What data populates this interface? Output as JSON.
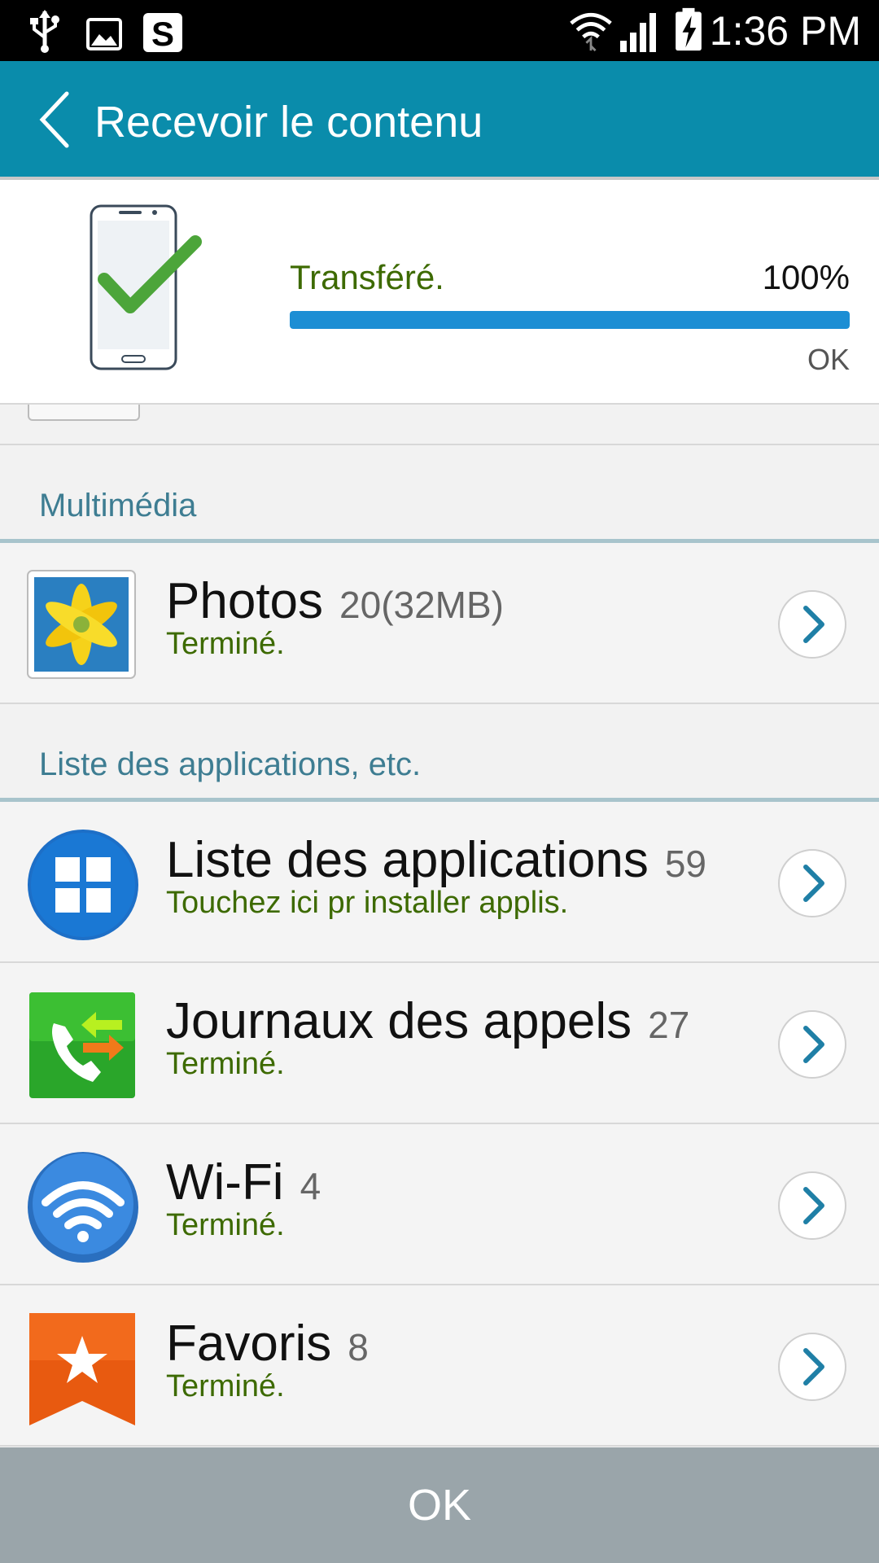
{
  "status_bar": {
    "time": "1:36 PM",
    "icons": [
      "usb-icon",
      "gallery-icon",
      "s-app-icon",
      "wifi-icon",
      "signal-icon",
      "battery-charging-icon"
    ]
  },
  "action_bar": {
    "title": "Recevoir le contenu"
  },
  "transfer": {
    "status": "Transféré.",
    "percent_label": "100%",
    "progress": 1.0,
    "ok_label": "OK"
  },
  "sections": [
    {
      "title": "Multimédia",
      "items": [
        {
          "title": "Photos",
          "count": "20(32MB)",
          "subtitle": "Terminé.",
          "icon": "photos-icon"
        }
      ]
    },
    {
      "title": "Liste des applications, etc.",
      "items": [
        {
          "title": "Liste des applications",
          "count": "59",
          "subtitle": "Touchez ici pr installer applis.",
          "icon": "apps-grid-icon"
        },
        {
          "title": "Journaux des appels",
          "count": "27",
          "subtitle": "Terminé.",
          "icon": "call-log-icon"
        },
        {
          "title": "Wi-Fi",
          "count": "4",
          "subtitle": "Terminé.",
          "icon": "wifi-settings-icon"
        },
        {
          "title": "Favoris",
          "count": "8",
          "subtitle": "Terminé.",
          "icon": "bookmark-star-icon"
        }
      ]
    }
  ],
  "bottom": {
    "ok_label": "OK"
  },
  "colors": {
    "action_bar": "#0a8cab",
    "progress": "#1c8ed4",
    "success_text": "#3d6a00",
    "section_title": "#3e7d92"
  }
}
